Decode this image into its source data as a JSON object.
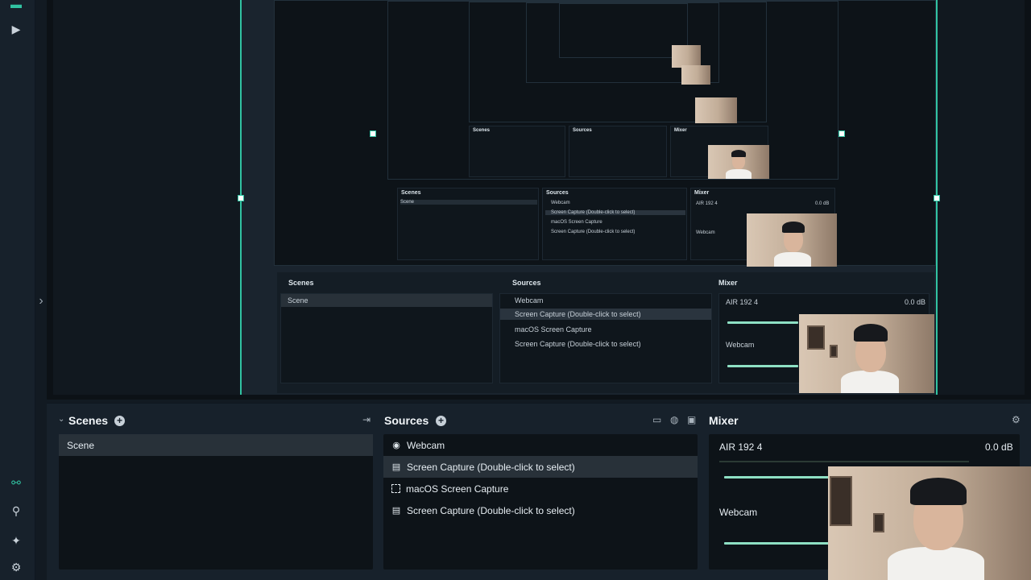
{
  "colors": {
    "accent": "#31c3a2",
    "panel": "#0d1318",
    "dock": "#17212b",
    "selected": "#283139"
  },
  "rail": {
    "icons": [
      "studio-mode-icon",
      "play-icon",
      "scene-transitions-icon",
      "add-source-icon",
      "magic-wand-icon",
      "settings-icon"
    ],
    "collapse_glyph": "›"
  },
  "preview": {
    "nested": {
      "scenes_title": "Scenes",
      "sources_title": "Sources",
      "mixer_title": "Mixer",
      "scene_item": "Scene",
      "sources": [
        "Webcam",
        "Screen Capture (Double-click to select)",
        "macOS Screen Capture",
        "Screen Capture (Double-click to select)"
      ],
      "mixer_channel": "AIR 192 4",
      "mixer_level": "0.0 dB",
      "mixer_webcam": "Webcam"
    }
  },
  "dock": {
    "scenes": {
      "title": "Scenes",
      "items": [
        "Scene"
      ],
      "selected_index": 0
    },
    "sources": {
      "title": "Sources",
      "items": [
        {
          "icon": "webcam-icon",
          "label": "Webcam"
        },
        {
          "icon": "window-capture-icon",
          "label": "Screen Capture (Double-click to select)"
        },
        {
          "icon": "display-capture-icon",
          "label": "macOS Screen Capture"
        },
        {
          "icon": "window-capture-icon",
          "label": "Screen Capture (Double-click to select)"
        }
      ],
      "selected_index": 1
    },
    "mixer": {
      "title": "Mixer",
      "channels": [
        {
          "name": "AIR 192 4",
          "level": "0.0 dB"
        },
        {
          "name": "Webcam",
          "level": ""
        }
      ]
    }
  }
}
